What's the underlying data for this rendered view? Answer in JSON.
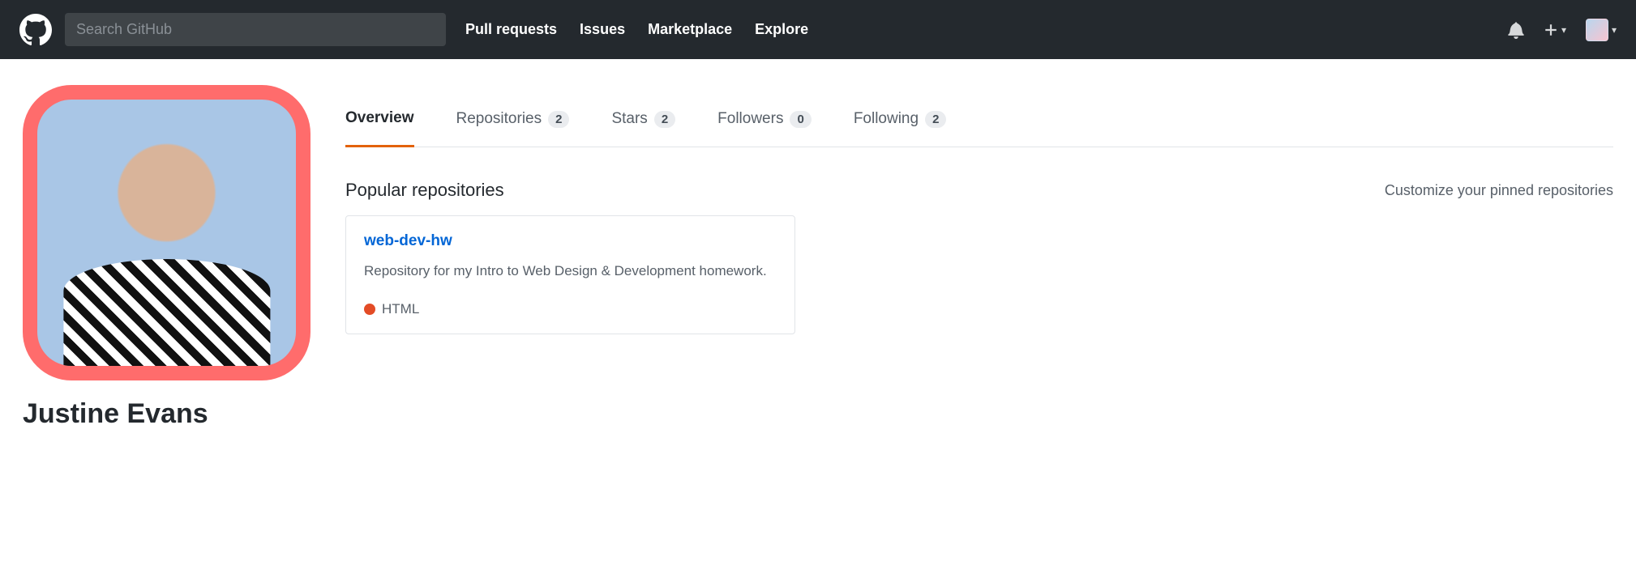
{
  "header": {
    "search_placeholder": "Search GitHub",
    "nav": {
      "pull_requests": "Pull requests",
      "issues": "Issues",
      "marketplace": "Marketplace",
      "explore": "Explore"
    }
  },
  "profile": {
    "name": "Justine Evans"
  },
  "tabs": {
    "overview": "Overview",
    "repositories": {
      "label": "Repositories",
      "count": "2"
    },
    "stars": {
      "label": "Stars",
      "count": "2"
    },
    "followers": {
      "label": "Followers",
      "count": "0"
    },
    "following": {
      "label": "Following",
      "count": "2"
    }
  },
  "section": {
    "title": "Popular repositories",
    "customize": "Customize your pinned repositories"
  },
  "repo": {
    "name": "web-dev-hw",
    "description": "Repository for my Intro to Web Design & Development homework.",
    "language": "HTML",
    "language_color": "#e34c26"
  }
}
